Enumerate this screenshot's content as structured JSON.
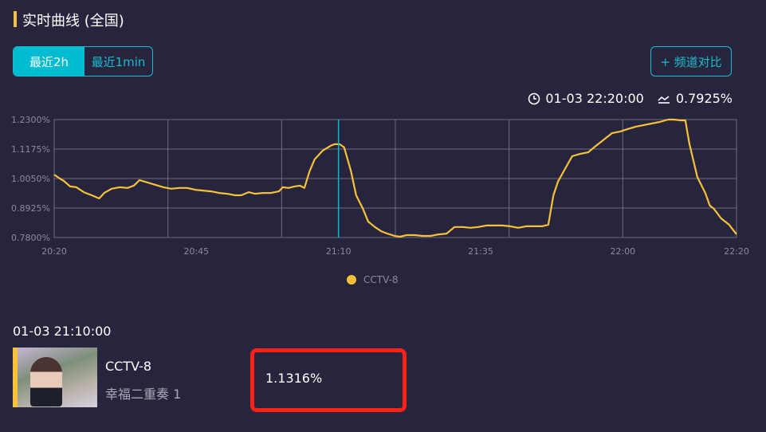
{
  "header": {
    "title": "实时曲线 (全国)"
  },
  "range_tabs": [
    {
      "label": "最近2h",
      "active": true
    },
    {
      "label": "最近1min",
      "active": false
    }
  ],
  "compare_button": "+ 频道对比",
  "current": {
    "time": "01-03 22:20:00",
    "value": "0.7925%"
  },
  "colors": {
    "accent": "#00bcd0",
    "line": "#f7c23a",
    "cursor": "#00bcd0",
    "highlight": "#ff2016"
  },
  "chart_data": {
    "type": "line",
    "x_unit": "minutes since 20:20",
    "x_tick_labels": [
      "20:20",
      "20:45",
      "21:10",
      "21:35",
      "22:00",
      "22:20"
    ],
    "x_tick_values": [
      0,
      25,
      50,
      75,
      100,
      120
    ],
    "y_tick_labels": [
      "1.2300%",
      "1.1175%",
      "1.0050%",
      "0.8925%",
      "0.7800%"
    ],
    "ylim": [
      0.78,
      1.23
    ],
    "xlim": [
      0,
      120
    ],
    "grid": true,
    "legend": {
      "label": "CCTV-8",
      "placement": "bottom-center"
    },
    "cursor_x": 50,
    "series": [
      {
        "name": "CCTV-8",
        "x": [
          0,
          1,
          1.7,
          2.8,
          3.9,
          5.2,
          6.6,
          7.9,
          8.8,
          10.1,
          11.5,
          12.9,
          14,
          15,
          16.4,
          17.8,
          19.2,
          20.6,
          22,
          23.4,
          24.8,
          26.2,
          27.6,
          29,
          30.4,
          31.8,
          32.9,
          34.2,
          35.3,
          36.7,
          38.1,
          39.5,
          40.2,
          41.2,
          42.3,
          43.2,
          44,
          44.9,
          45.8,
          47.2,
          48.6,
          49.3,
          50.2,
          51,
          52.2,
          53.1,
          54.3,
          55.2,
          56.4,
          57.5,
          58.6,
          59.9,
          60.8,
          62,
          63.4,
          64.8,
          66.2,
          67.6,
          69,
          70.4,
          71.8,
          73.2,
          74.6,
          76,
          77.4,
          78.8,
          80.2,
          81.6,
          83,
          84.4,
          85.8,
          86.9,
          87.8,
          88.6,
          90,
          91.1,
          92.5,
          93.9,
          95.3,
          96.7,
          98.1,
          99.5,
          100.9,
          102.3,
          103.7,
          105.1,
          106.5,
          108,
          108.9,
          110.3,
          111,
          111.7,
          113.1,
          114.5,
          115.3,
          116,
          117.3,
          118.7,
          120
        ],
        "y": [
          1.02,
          1.005,
          0.996,
          0.975,
          0.972,
          0.953,
          0.941,
          0.929,
          0.95,
          0.966,
          0.972,
          0.969,
          0.978,
          0.999,
          0.99,
          0.981,
          0.972,
          0.966,
          0.969,
          0.969,
          0.962,
          0.959,
          0.956,
          0.95,
          0.947,
          0.941,
          0.941,
          0.953,
          0.947,
          0.95,
          0.95,
          0.956,
          0.972,
          0.969,
          0.975,
          0.978,
          0.969,
          1.032,
          1.078,
          1.111,
          1.13,
          1.136,
          1.136,
          1.124,
          1.032,
          0.941,
          0.89,
          0.841,
          0.82,
          0.804,
          0.795,
          0.786,
          0.783,
          0.789,
          0.789,
          0.786,
          0.786,
          0.792,
          0.795,
          0.82,
          0.82,
          0.817,
          0.82,
          0.826,
          0.826,
          0.826,
          0.823,
          0.817,
          0.823,
          0.823,
          0.823,
          0.829,
          0.941,
          0.993,
          1.048,
          1.09,
          1.099,
          1.105,
          1.13,
          1.154,
          1.178,
          1.184,
          1.194,
          1.203,
          1.209,
          1.215,
          1.221,
          1.23,
          1.23,
          1.227,
          1.227,
          1.139,
          1.011,
          0.95,
          0.902,
          0.89,
          0.853,
          0.829,
          0.7925
        ]
      }
    ]
  },
  "detail": {
    "time": "01-03 21:10:00",
    "channel": "CCTV-8",
    "program": "幸福二重奏 1",
    "value": "1.1316%"
  }
}
